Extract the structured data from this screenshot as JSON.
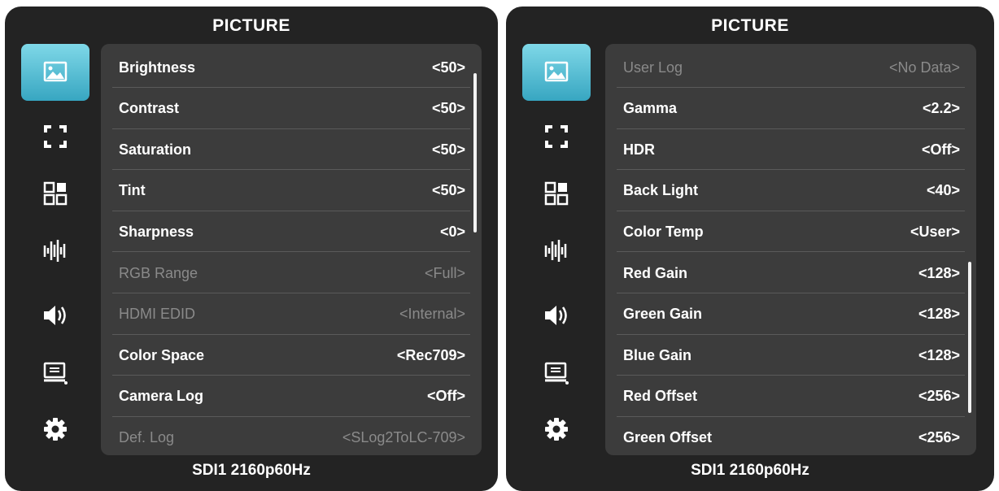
{
  "left_panel": {
    "title": "PICTURE",
    "status": "SDI1 2160p60Hz",
    "sidebar": [
      {
        "icon": "picture-icon",
        "active": true
      },
      {
        "icon": "aspect-ratio-icon"
      },
      {
        "icon": "grid-layout-icon"
      },
      {
        "icon": "audio-meter-icon"
      },
      {
        "icon": "speaker-icon"
      },
      {
        "icon": "display-icon"
      },
      {
        "icon": "gear-icon"
      }
    ],
    "rows": [
      {
        "label": "Brightness",
        "value": "<50>",
        "enabled": true
      },
      {
        "label": "Contrast",
        "value": "<50>",
        "enabled": true
      },
      {
        "label": "Saturation",
        "value": "<50>",
        "enabled": true
      },
      {
        "label": "Tint",
        "value": "<50>",
        "enabled": true
      },
      {
        "label": "Sharpness",
        "value": "<0>",
        "enabled": true
      },
      {
        "label": "RGB Range",
        "value": "<Full>",
        "enabled": false
      },
      {
        "label": "HDMI EDID",
        "value": "<Internal>",
        "enabled": false
      },
      {
        "label": "Color Space",
        "value": "<Rec709>",
        "enabled": true
      },
      {
        "label": "Camera Log",
        "value": "<Off>",
        "enabled": true
      },
      {
        "label": "Def. Log",
        "value": "<SLog2ToLC-709>",
        "enabled": false
      }
    ]
  },
  "right_panel": {
    "title": "PICTURE",
    "status": "SDI1 2160p60Hz",
    "sidebar": [
      {
        "icon": "picture-icon",
        "active": true
      },
      {
        "icon": "aspect-ratio-icon"
      },
      {
        "icon": "grid-layout-icon"
      },
      {
        "icon": "audio-meter-icon"
      },
      {
        "icon": "speaker-icon"
      },
      {
        "icon": "display-icon"
      },
      {
        "icon": "gear-icon"
      }
    ],
    "rows": [
      {
        "label": "User Log",
        "value": "<No Data>",
        "enabled": false
      },
      {
        "label": "Gamma",
        "value": "<2.2>",
        "enabled": true
      },
      {
        "label": "HDR",
        "value": "<Off>",
        "enabled": true
      },
      {
        "label": "Back Light",
        "value": "<40>",
        "enabled": true
      },
      {
        "label": "Color Temp",
        "value": "<User>",
        "enabled": true
      },
      {
        "label": "Red Gain",
        "value": "<128>",
        "enabled": true
      },
      {
        "label": "Green Gain",
        "value": "<128>",
        "enabled": true
      },
      {
        "label": "Blue Gain",
        "value": "<128>",
        "enabled": true
      },
      {
        "label": "Red Offset",
        "value": "<256>",
        "enabled": true
      },
      {
        "label": "Green Offset",
        "value": "<256>",
        "enabled": true
      }
    ]
  },
  "colors": {
    "panel_bg": "#232323",
    "list_bg": "#3c3c3c",
    "active_tab": "#4fbcd3",
    "text": "#ffffff",
    "disabled_text": "#8a8a8a"
  }
}
